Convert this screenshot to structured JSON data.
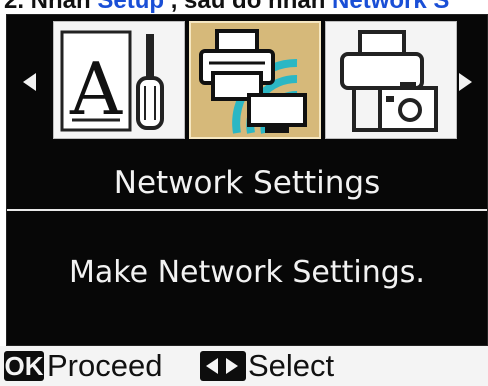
{
  "caption": {
    "prefix": "2. Nhấn ",
    "setup_link": "Setup",
    "middle": " , sau đó nhấn ",
    "network_link": "Network S"
  },
  "lcd": {
    "menu_icons": [
      {
        "icon": "setup-tools-icon",
        "selected": false
      },
      {
        "icon": "network-printer-icon",
        "selected": true
      },
      {
        "icon": "photo-print-icon",
        "selected": false
      }
    ],
    "title": "Network Settings",
    "message": "Make Network Settings."
  },
  "guide": {
    "ok_key": "OK",
    "proceed_label": "Proceed",
    "select_label": "Select"
  },
  "colors": {
    "screen_bg": "#070707",
    "selected_tile": "#d6b97a",
    "wifi_arcs": "#2bb7c4",
    "link_blue": "#1a4fd6"
  }
}
